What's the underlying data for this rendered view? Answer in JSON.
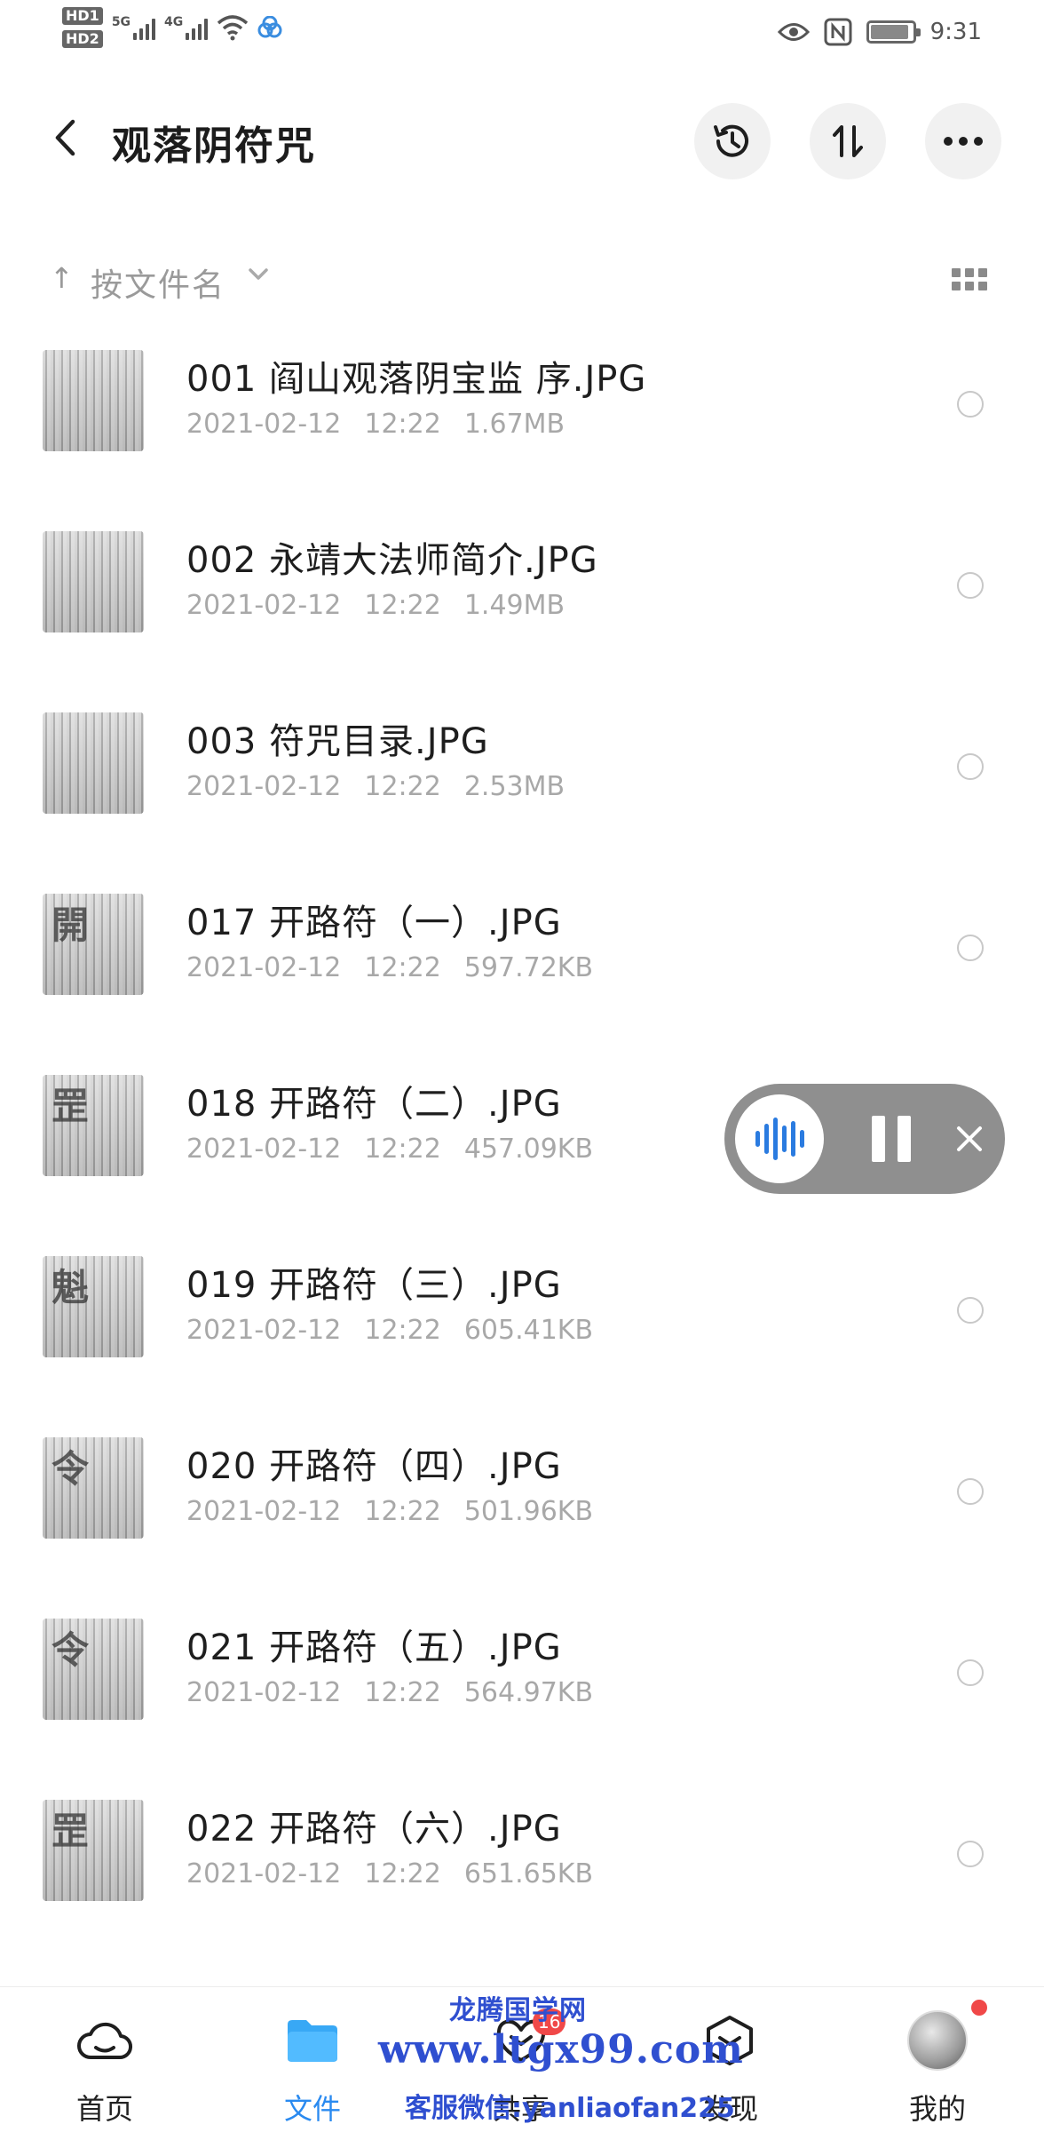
{
  "status_bar": {
    "hd1": "HD1",
    "hd2": "HD2",
    "sim1": "5G",
    "sim2": "4G",
    "time": "9:31"
  },
  "header": {
    "title": "观落阴符咒",
    "buttons": [
      "history-icon",
      "sort-toggle-icon",
      "more-icon"
    ]
  },
  "sort": {
    "label": "按文件名"
  },
  "files": [
    {
      "name": "001 阎山观落阴宝监 序.JPG",
      "date": "2021-02-12",
      "time": "12:22",
      "size": "1.67MB",
      "thumb_text": ""
    },
    {
      "name": "002 永靖大法师简介.JPG",
      "date": "2021-02-12",
      "time": "12:22",
      "size": "1.49MB",
      "thumb_text": ""
    },
    {
      "name": "003 符咒目录.JPG",
      "date": "2021-02-12",
      "time": "12:22",
      "size": "2.53MB",
      "thumb_text": ""
    },
    {
      "name": "017 开路符（一）.JPG",
      "date": "2021-02-12",
      "time": "12:22",
      "size": "597.72KB",
      "thumb_text": "開"
    },
    {
      "name": "018 开路符（二）.JPG",
      "date": "2021-02-12",
      "time": "12:22",
      "size": "457.09KB",
      "thumb_text": "罡"
    },
    {
      "name": "019 开路符（三）.JPG",
      "date": "2021-02-12",
      "time": "12:22",
      "size": "605.41KB",
      "thumb_text": "魁"
    },
    {
      "name": "020 开路符（四）.JPG",
      "date": "2021-02-12",
      "time": "12:22",
      "size": "501.96KB",
      "thumb_text": "令"
    },
    {
      "name": "021 开路符（五）.JPG",
      "date": "2021-02-12",
      "time": "12:22",
      "size": "564.97KB",
      "thumb_text": "令"
    },
    {
      "name": "022 开路符（六）.JPG",
      "date": "2021-02-12",
      "time": "12:22",
      "size": "651.65KB",
      "thumb_text": "罡"
    }
  ],
  "bottom_nav": {
    "items": [
      {
        "label": "首页",
        "icon": "cloud-icon"
      },
      {
        "label": "文件",
        "icon": "folder-icon"
      },
      {
        "label": "共享",
        "icon": "share-icon"
      },
      {
        "label": "发现",
        "icon": "discover-icon"
      },
      {
        "label": "我的",
        "icon": "avatar"
      }
    ],
    "badge": "16",
    "active_index": 1
  },
  "watermark": {
    "name": "龙腾国学网",
    "site": "www.ltgx99.com",
    "contact": "客服微信:yanliaofan225"
  },
  "colors": {
    "accent": "#2a8af0",
    "badge": "#f04848",
    "watermark": "#2f4fd0"
  }
}
